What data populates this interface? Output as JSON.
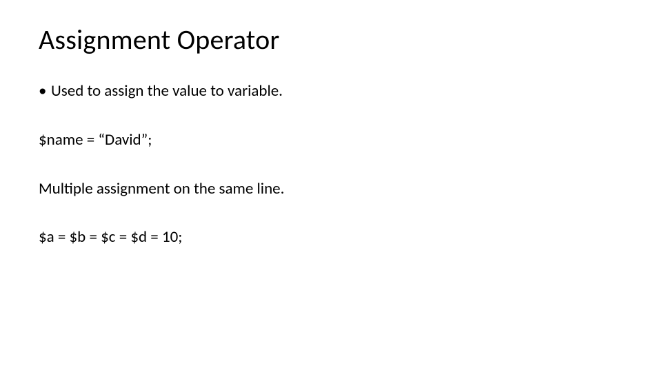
{
  "slide": {
    "title": "Assignment Operator",
    "bullet_marker": "•",
    "lines": {
      "l1": "Used to assign the value to variable.",
      "l2": "$name = “David”;",
      "l3": "Multiple assignment on the same line.",
      "l4": "$a = $b = $c = $d = 10;"
    }
  }
}
